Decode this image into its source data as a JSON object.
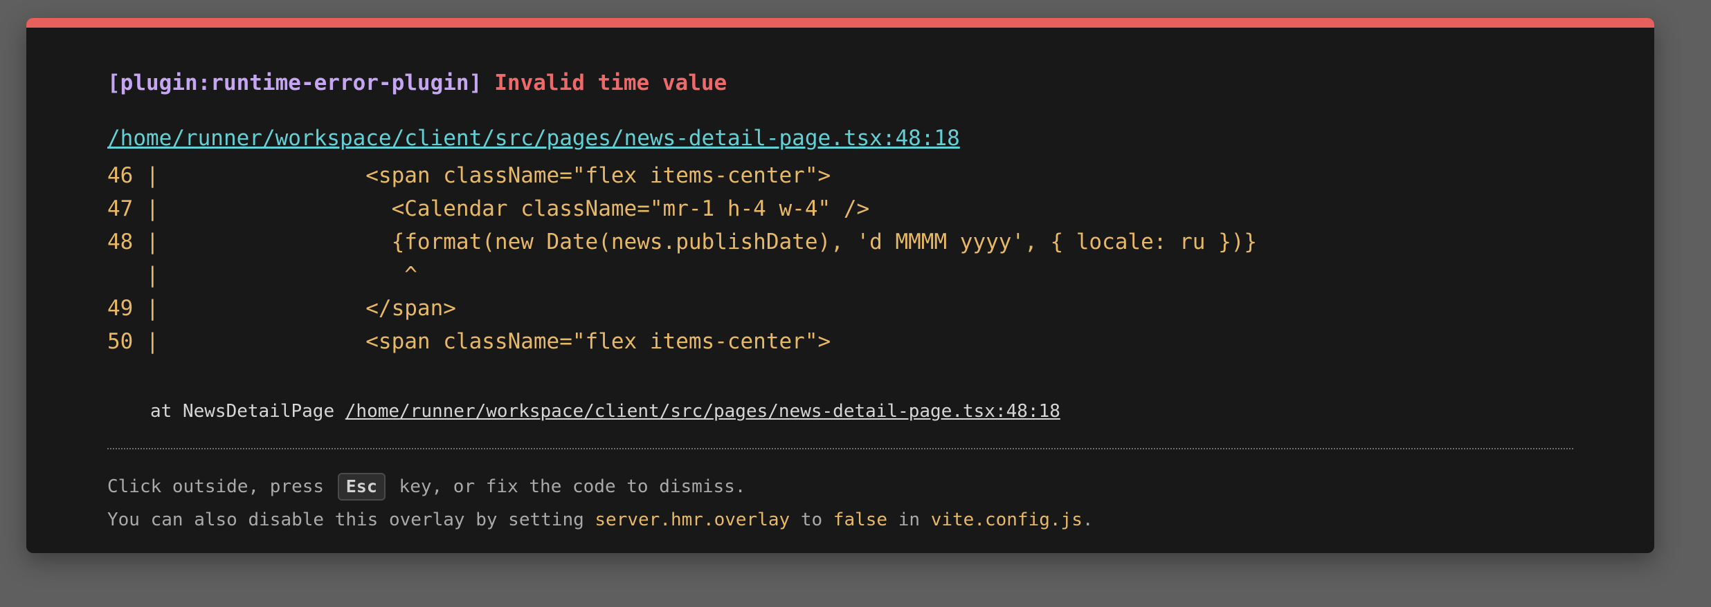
{
  "overlay": {
    "plugin": "[plugin:runtime-error-plugin]",
    "message": "Invalid time value",
    "file": "/home/runner/workspace/client/src/pages/news-detail-page.tsx:48:18",
    "code_frame": [
      "46 |                <span className=\"flex items-center\">",
      "47 |                  <Calendar className=\"mr-1 h-4 w-4\" />",
      "48 |                  {format(new Date(news.publishDate), 'd MMMM yyyy', { locale: ru })}",
      "   |                   ^",
      "49 |                </span>",
      "50 |                <span className=\"flex items-center\">"
    ],
    "stack_prefix": "at NewsDetailPage ",
    "stack_file": "/home/runner/workspace/client/src/pages/news-detail-page.tsx:48:18"
  },
  "tip": {
    "line1_part1": "Click outside, press ",
    "esc_key": "Esc",
    "line1_part2": " key, or fix the code to dismiss.",
    "line2_part1": "You can also disable this overlay by setting ",
    "setting": "server.hmr.overlay",
    "line2_part2": " to ",
    "value": "false",
    "line2_part3": " in ",
    "config_file": "vite.config.js",
    "line2_part4": "."
  },
  "colors": {
    "accent_bar": "#e8605c",
    "plugin": "#c6a6f3",
    "error": "#ee6a6a",
    "link": "#62d1d6",
    "code": "#e7b866",
    "background": "#181818"
  }
}
